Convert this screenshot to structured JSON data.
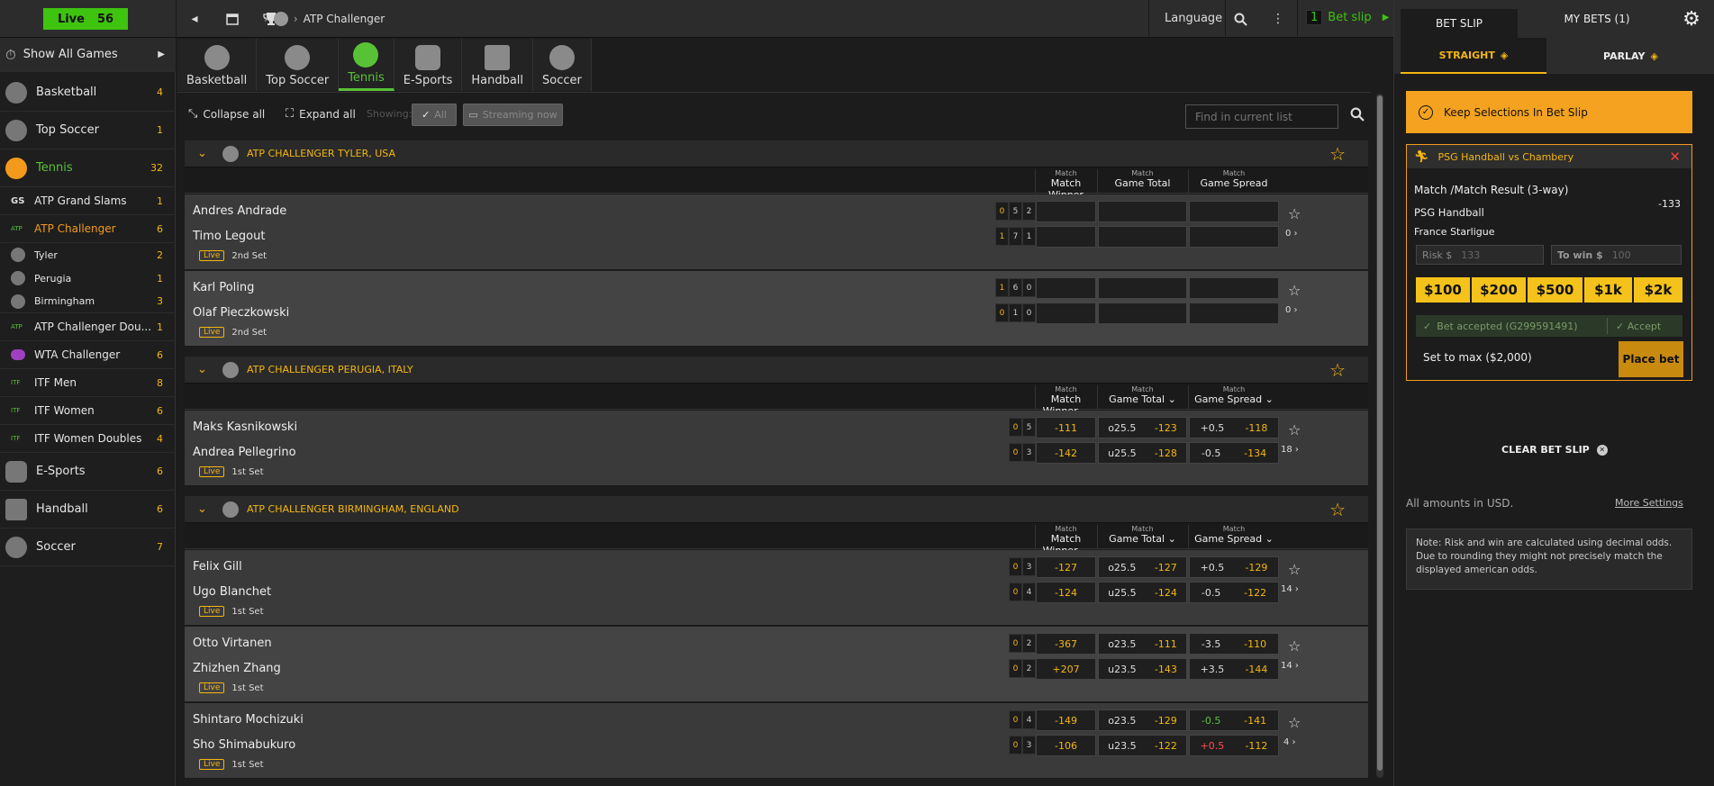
{
  "topbar": {
    "live_label": "Live",
    "live_count": "56",
    "breadcrumb": "ATP Challenger",
    "language": "Language",
    "betslip_count": "1",
    "betslip_label": "Bet slip"
  },
  "sidebar": {
    "show_all": "Show All Games",
    "items": [
      {
        "label": "Basketball",
        "count": "4"
      },
      {
        "label": "Top Soccer",
        "count": "1"
      },
      {
        "label": "Tennis",
        "count": "32"
      },
      {
        "label": "ATP Grand Slams",
        "count": "1"
      },
      {
        "label": "ATP Challenger",
        "count": "6"
      },
      {
        "label": "Tyler",
        "count": "2"
      },
      {
        "label": "Perugia",
        "count": "1"
      },
      {
        "label": "Birmingham",
        "count": "3"
      },
      {
        "label": "ATP Challenger Dou...",
        "count": "1"
      },
      {
        "label": "WTA Challenger",
        "count": "6"
      },
      {
        "label": "ITF Men",
        "count": "8"
      },
      {
        "label": "ITF Women",
        "count": "6"
      },
      {
        "label": "ITF Women Doubles",
        "count": "4"
      },
      {
        "label": "E-Sports",
        "count": "6"
      },
      {
        "label": "Handball",
        "count": "6"
      },
      {
        "label": "Soccer",
        "count": "7"
      }
    ],
    "gs_badge": "GS"
  },
  "sport_tabs": [
    "Basketball",
    "Top Soccer",
    "Tennis",
    "E-Sports",
    "Handball",
    "Soccer"
  ],
  "toolbar": {
    "collapse": "Collapse all",
    "expand": "Expand all",
    "showing": "Showing:",
    "all": "All",
    "streaming": "Streaming now",
    "find_placeholder": "Find in current list"
  },
  "columns": {
    "small": "Match",
    "winner": "Match Winner",
    "total": "Game Total",
    "spread": "Game Spread"
  },
  "leagues": [
    {
      "name": "ATP CHALLENGER TYLER, USA"
    },
    {
      "name": "ATP CHALLENGER PERUGIA, ITALY"
    },
    {
      "name": "ATP CHALLENGER BIRMINGHAM, ENGLAND"
    }
  ],
  "events": [
    {
      "p1": "Andres Andrade",
      "p2": "Timo Legout",
      "live": "Live",
      "set": "2nd Set",
      "s1": [
        "0",
        "5",
        "2"
      ],
      "s2": [
        "1",
        "7",
        "1"
      ],
      "more": "0",
      "odds": []
    },
    {
      "p1": "Karl Poling",
      "p2": "Olaf Pieczkowski",
      "live": "Live",
      "set": "2nd Set",
      "s1": [
        "1",
        "6",
        "0"
      ],
      "s2": [
        "0",
        "1",
        "0"
      ],
      "more": "0",
      "odds": []
    },
    {
      "p1": "Maks Kasnikowski",
      "p2": "Andrea Pellegrino",
      "live": "Live",
      "set": "1st Set",
      "s1": [
        "0",
        "5"
      ],
      "s2": [
        "0",
        "3"
      ],
      "more": "18",
      "odds": [
        [
          "-111",
          "o25.5",
          "-123",
          "+0.5",
          "-118"
        ],
        [
          "-142",
          "u25.5",
          "-128",
          "-0.5",
          "-134"
        ]
      ]
    },
    {
      "p1": "Felix Gill",
      "p2": "Ugo Blanchet",
      "live": "Live",
      "set": "1st Set",
      "s1": [
        "0",
        "3"
      ],
      "s2": [
        "0",
        "4"
      ],
      "more": "14",
      "odds": [
        [
          "-127",
          "o25.5",
          "-127",
          "+0.5",
          "-129"
        ],
        [
          "-124",
          "u25.5",
          "-124",
          "-0.5",
          "-122"
        ]
      ]
    },
    {
      "p1": "Otto Virtanen",
      "p2": "Zhizhen Zhang",
      "live": "Live",
      "set": "1st Set",
      "s1": [
        "0",
        "2"
      ],
      "s2": [
        "0",
        "2"
      ],
      "more": "14",
      "odds": [
        [
          "-367",
          "o23.5",
          "-111",
          "-3.5",
          "-110"
        ],
        [
          "+207",
          "u23.5",
          "-143",
          "+3.5",
          "-144"
        ]
      ]
    },
    {
      "p1": "Shintaro Mochizuki",
      "p2": "Sho Shimabukuro",
      "live": "Live",
      "set": "1st Set",
      "s1": [
        "0",
        "4"
      ],
      "s2": [
        "0",
        "3"
      ],
      "more": "4",
      "odds": [
        [
          "-149",
          "o23.5",
          "-129",
          "-0.5",
          "-141"
        ],
        [
          "-106",
          "u23.5",
          "-122",
          "+0.5",
          "-112"
        ]
      ]
    }
  ],
  "right_panel": {
    "tab_betslip": "BET SLIP",
    "tab_mybets": "MY BETS (1)",
    "straight": "STRAIGHT",
    "parlay": "PARLAY",
    "keep": "Keep Selections In Bet Slip",
    "slip_title": "PSG Handball vs Chambery",
    "market": "Match /Match Result (3-way)",
    "selection": "PSG Handball",
    "odds": "-133",
    "league": "France Starligue",
    "risk_label": "Risk $",
    "risk_placeholder": "133",
    "win_label": "To win $",
    "win_placeholder": "100",
    "stakes": [
      "$100",
      "$200",
      "$500",
      "$1k",
      "$2k"
    ],
    "accepted": "Bet accepted (G299591491)",
    "accept": "Accept",
    "setmax": "Set to max ($2,000)",
    "place": "Place bet",
    "clear": "CLEAR BET SLIP",
    "usd": "All amounts in USD.",
    "more_settings": "More Settings",
    "note": "Note: Risk and win are calculated using decimal odds. Due to rounding they might not precisely match the displayed american odds."
  },
  "colors": {
    "accent_yellow": "#f3b612",
    "live_green": "#3ec30f",
    "tennis_green": "#58c236",
    "slip_orange": "#f4a21f"
  }
}
